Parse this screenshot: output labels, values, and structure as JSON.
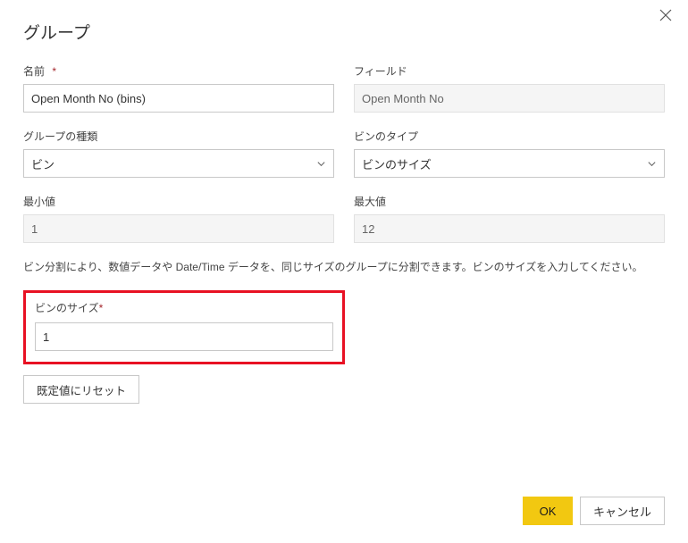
{
  "dialog": {
    "title": "グループ",
    "close_icon": "close"
  },
  "fields": {
    "name": {
      "label": "名前",
      "required": "*",
      "value": "Open Month No (bins)"
    },
    "field": {
      "label": "フィールド",
      "value": "Open Month No"
    },
    "group_type": {
      "label": "グループの種類",
      "value": "ビン"
    },
    "bin_type": {
      "label": "ビンのタイプ",
      "value": "ビンのサイズ"
    },
    "min": {
      "label": "最小値",
      "value": "1"
    },
    "max": {
      "label": "最大値",
      "value": "12"
    },
    "bin_size": {
      "label": "ビンのサイズ",
      "required": "*",
      "value": "1"
    }
  },
  "help_text": "ビン分割により、数値データや Date/Time データを、同じサイズのグループに分割できます。ビンのサイズを入力してください。",
  "buttons": {
    "reset": "既定値にリセット",
    "ok": "OK",
    "cancel": "キャンセル"
  }
}
